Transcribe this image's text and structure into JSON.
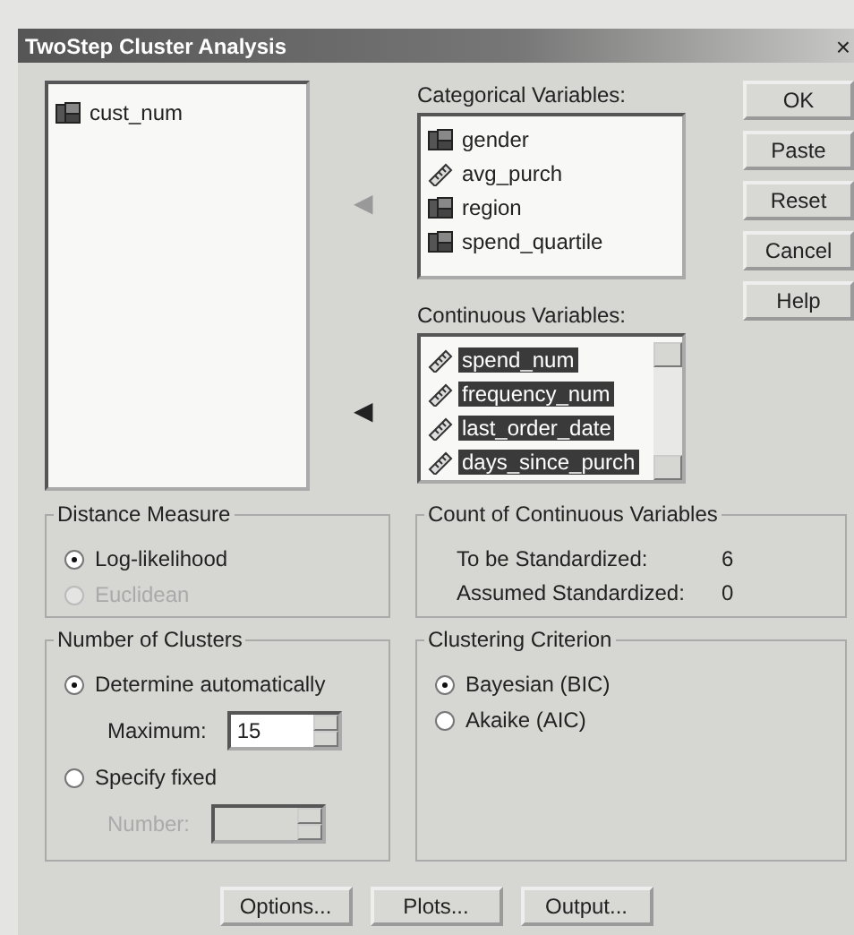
{
  "window": {
    "title": "TwoStep Cluster Analysis",
    "close": "×"
  },
  "source_list": {
    "items": [
      {
        "label": "cust_num",
        "kind": "nominal",
        "selected": false
      }
    ]
  },
  "move_arrows": [
    {
      "glyph": "◀",
      "disabled": true
    },
    {
      "glyph": "◀",
      "disabled": false
    }
  ],
  "categorical": {
    "label": "Categorical Variables:",
    "items": [
      {
        "label": "gender",
        "kind": "nominal",
        "selected": false
      },
      {
        "label": "avg_purch",
        "kind": "scale",
        "selected": false
      },
      {
        "label": "region",
        "kind": "nominal",
        "selected": false
      },
      {
        "label": "spend_quartile",
        "kind": "nominal",
        "selected": false
      }
    ]
  },
  "continuous": {
    "label": "Continuous Variables:",
    "items": [
      {
        "label": "spend_num",
        "kind": "scale",
        "selected": true
      },
      {
        "label": "frequency_num",
        "kind": "scale",
        "selected": true
      },
      {
        "label": "last_order_date",
        "kind": "scale",
        "selected": true
      },
      {
        "label": "days_since_purch",
        "kind": "scale",
        "selected": true
      }
    ]
  },
  "buttons": [
    "OK",
    "Paste",
    "Reset",
    "Cancel",
    "Help"
  ],
  "distance_measure": {
    "title": "Distance Measure",
    "options": [
      {
        "label": "Log-likelihood",
        "selected": true,
        "disabled": false
      },
      {
        "label": "Euclidean",
        "selected": false,
        "disabled": true
      }
    ]
  },
  "count_of_continuous": {
    "title": "Count of Continuous Variables",
    "rows": [
      {
        "label": "To be Standardized:",
        "value": "6"
      },
      {
        "label": "Assumed Standardized:",
        "value": "0"
      }
    ]
  },
  "number_of_clusters": {
    "title": "Number of Clusters",
    "options": [
      {
        "label": "Determine automatically",
        "selected": true,
        "disabled": false,
        "spin": {
          "label": "Maximum:",
          "value": "15",
          "disabled": false
        }
      },
      {
        "label": "Specify fixed",
        "selected": false,
        "disabled": false,
        "spin": {
          "label": "Number:",
          "disabled": true
        }
      }
    ]
  },
  "clustering_criterion": {
    "title": "Clustering Criterion",
    "options": [
      {
        "label": "Bayesian (BIC)",
        "selected": true,
        "disabled": false
      },
      {
        "label": "Akaike (AIC)",
        "selected": false,
        "disabled": false
      }
    ]
  },
  "bottom_buttons": [
    "Options...",
    "Plots...",
    "Output..."
  ]
}
